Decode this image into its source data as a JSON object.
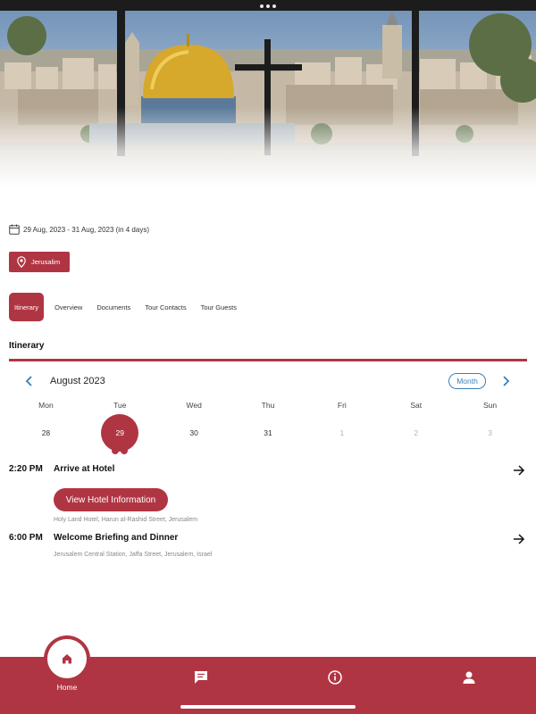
{
  "trip": {
    "date_range": "29 Aug, 2023 - 31 Aug, 2023 (in 4 days)",
    "location": "Jerusalim"
  },
  "tabs": [
    {
      "label": "Itinerary",
      "active": true
    },
    {
      "label": "Overview",
      "active": false
    },
    {
      "label": "Documents",
      "active": false
    },
    {
      "label": "Tour Contacts",
      "active": false
    },
    {
      "label": "Tour Guests",
      "active": false
    }
  ],
  "itinerary": {
    "title": "Itinerary",
    "calendar": {
      "month_label": "August 2023",
      "mode_label": "Month",
      "weekdays": [
        "Mon",
        "Tue",
        "Wed",
        "Thu",
        "Fri",
        "Sat",
        "Sun"
      ],
      "days": [
        {
          "num": "28",
          "muted": false,
          "selected": false
        },
        {
          "num": "29",
          "muted": false,
          "selected": true,
          "event_count": 2
        },
        {
          "num": "30",
          "muted": false,
          "selected": false
        },
        {
          "num": "31",
          "muted": false,
          "selected": false
        },
        {
          "num": "1",
          "muted": true,
          "selected": false
        },
        {
          "num": "2",
          "muted": true,
          "selected": false
        },
        {
          "num": "3",
          "muted": true,
          "selected": false
        }
      ]
    },
    "events": [
      {
        "time": "2:20 PM",
        "title": "Arrive at Hotel",
        "button_label": "View Hotel Information",
        "address": "Holy Land Hotel, Harun al-Rashid Street, Jerusalem"
      },
      {
        "time": "6:00 PM",
        "title": "Welcome Briefing and Dinner",
        "address": "Jerusalem Central Station, Jaffa Street, Jerusalem, Israel"
      }
    ]
  },
  "bottom_nav": {
    "home_label": "Home",
    "items": [
      "home-icon",
      "chat-icon",
      "info-icon",
      "profile-icon"
    ]
  },
  "colors": {
    "accent": "#b03543",
    "link": "#3a7fb8"
  }
}
